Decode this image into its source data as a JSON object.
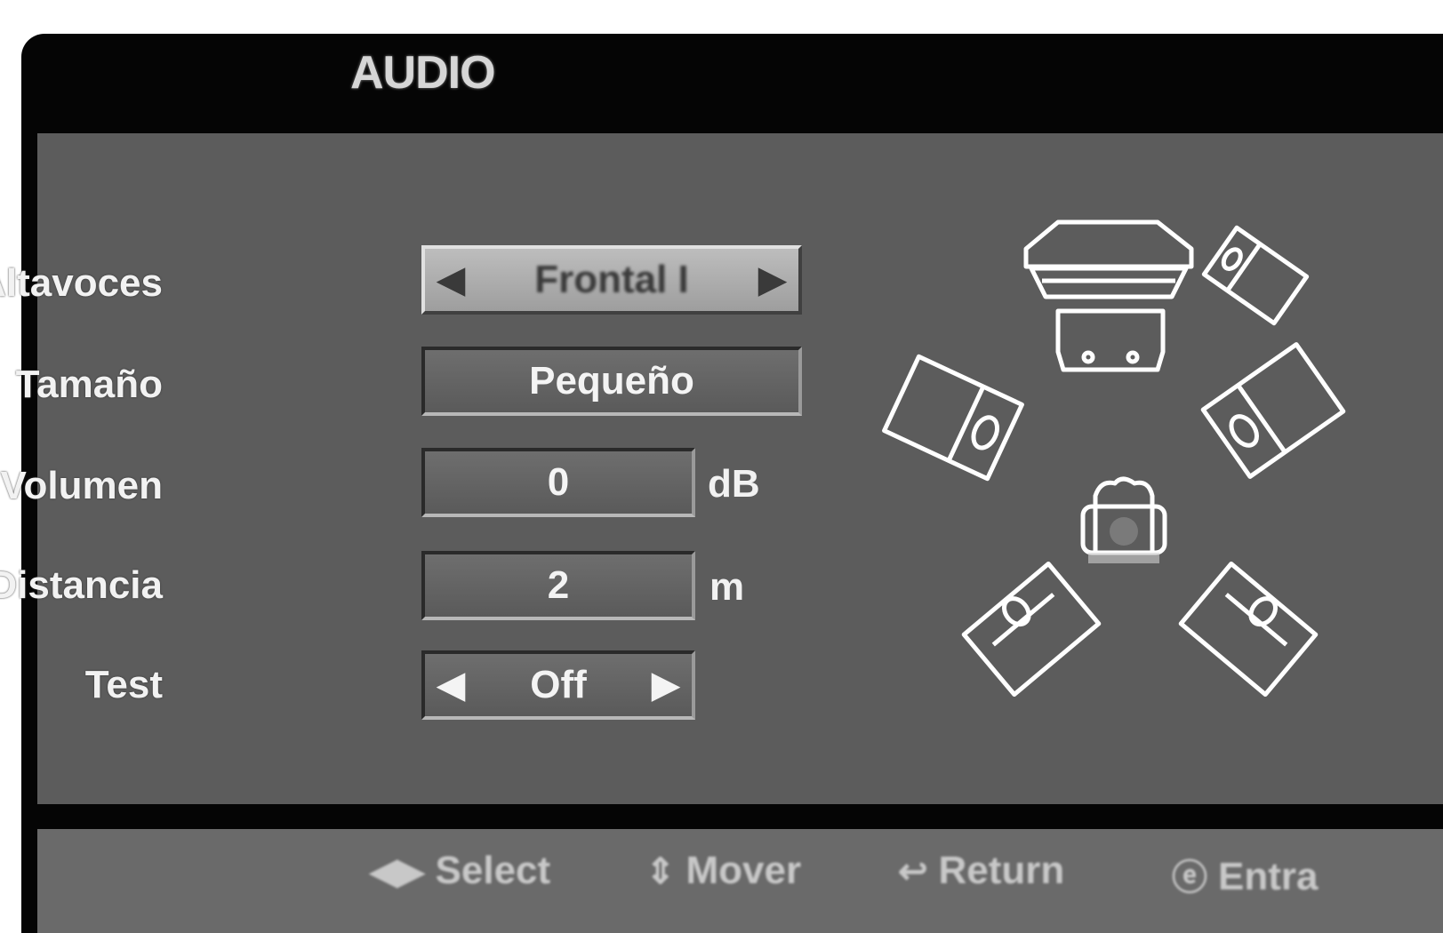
{
  "window": {
    "title": "AUDIO"
  },
  "settings": {
    "speakers_label": "Altavoces",
    "speakers_value": "Frontal I",
    "size_label": "Tamaño",
    "size_value": "Pequeño",
    "volume_label": "Volumen",
    "volume_value": "0",
    "volume_unit": "dB",
    "distance_label": "Distancia",
    "distance_value": "2",
    "distance_unit": "m",
    "test_label": "Test",
    "test_value": "Off"
  },
  "icons": {
    "left": "◀",
    "right": "▶",
    "select": "◀▶",
    "move": "⇕",
    "return": "↩",
    "enter": "ⓔ"
  },
  "footer": {
    "select": "Select",
    "move": "Mover",
    "return": "Return",
    "enter": "Entra"
  },
  "colors": {
    "panel": "#5c5c5c",
    "highlight": "#b0b0b0",
    "frame": "#050505"
  }
}
